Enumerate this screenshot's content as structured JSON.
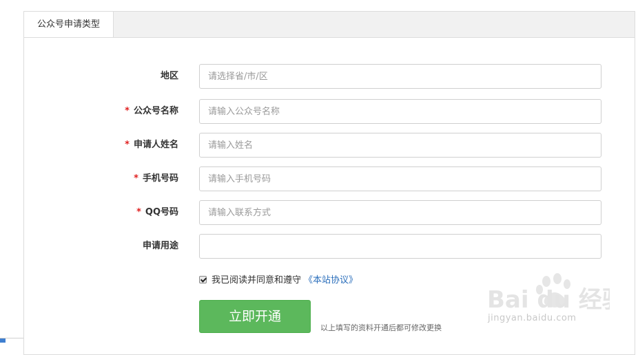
{
  "tab": {
    "label": "公众号申请类型"
  },
  "form": {
    "region": {
      "label": "地区",
      "required": false,
      "placeholder": "请选择省/市/区"
    },
    "account_name": {
      "label": "公众号名称",
      "required": true,
      "placeholder": "请输入公众号名称"
    },
    "applicant_name": {
      "label": "申请人姓名",
      "required": true,
      "placeholder": "请输入姓名"
    },
    "phone": {
      "label": "手机号码",
      "required": true,
      "placeholder": "请输入手机号码"
    },
    "qq": {
      "label": "QQ号码",
      "required": true,
      "placeholder": "请输入联系方式"
    },
    "purpose": {
      "label": "申请用途",
      "required": false,
      "placeholder": ""
    },
    "required_mark": "*"
  },
  "agreement": {
    "checked": true,
    "text": "我已阅读并同意和遵守",
    "link_text": "《本站协议》"
  },
  "submit": {
    "label": "立即开通",
    "note": "以上填写的资料开通后都可修改更换"
  },
  "watermark": {
    "logo_text": "Bai du 经验",
    "url_text": "jingyan.baidu.com"
  },
  "colors": {
    "accent_green": "#5cb85c",
    "link_blue": "#2a6ebb",
    "required_red": "#e02020"
  }
}
